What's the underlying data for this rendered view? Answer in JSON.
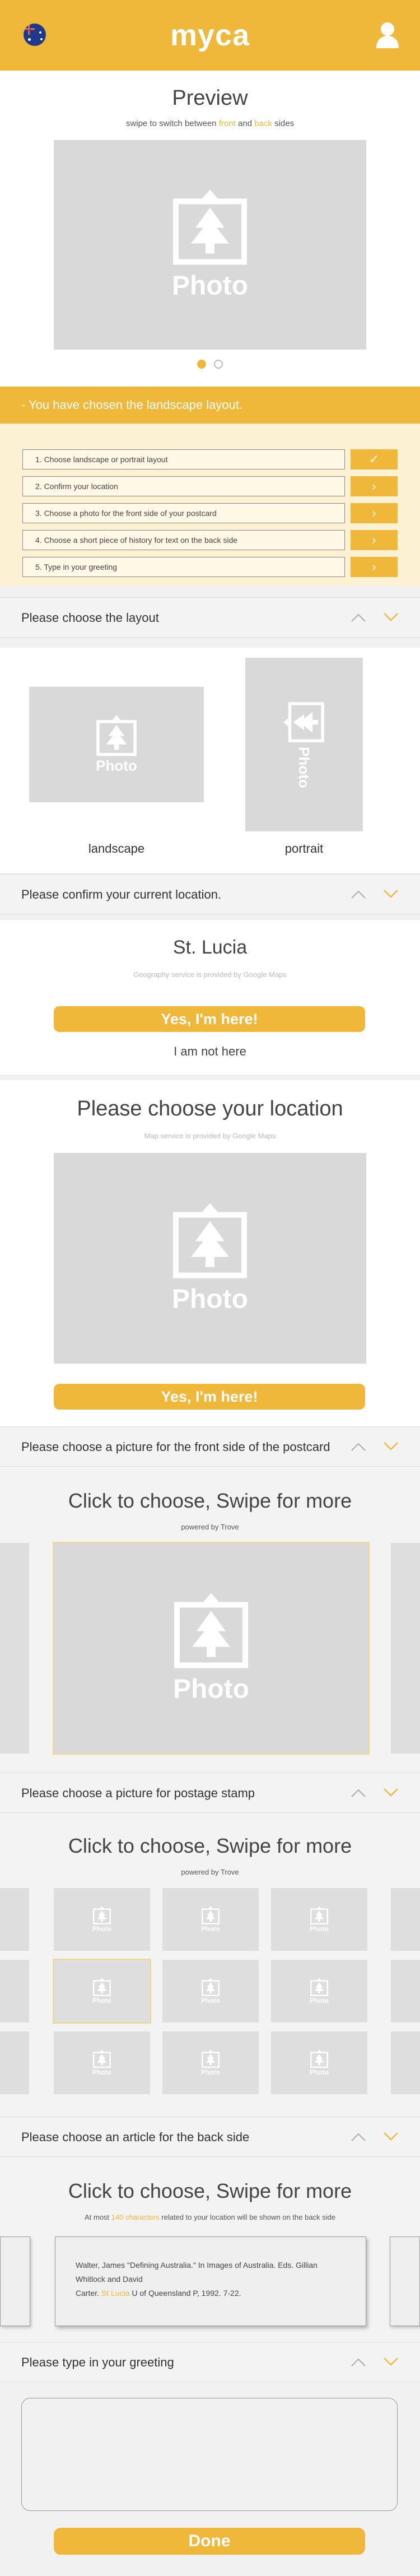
{
  "header": {
    "flag_icon": "australia-flag-icon",
    "logo": "myca",
    "user_icon": "user-icon",
    "brand_color": "#f0b83a"
  },
  "preview": {
    "title": "Preview",
    "hint_pre": "swipe to switch between ",
    "hint_front": "front",
    "hint_and": " and ",
    "hint_back": "back",
    "hint_post": " sides",
    "photo_label": "Photo",
    "dots_active": 0
  },
  "banner": "- You have chosen the landscape layout.",
  "steps": [
    {
      "label": "1. Choose landscape or portrait layout",
      "icon": "✓"
    },
    {
      "label": "2. Confirm your location",
      "icon": "›"
    },
    {
      "label": "3. Choose a photo for the front side of your postcard",
      "icon": "›"
    },
    {
      "label": "4. Choose a short piece of history for text on the back side",
      "icon": "›"
    },
    {
      "label": "5. Type in your greeting",
      "icon": "›"
    }
  ],
  "layout_section": {
    "header": "Please choose the layout",
    "landscape_label": "landscape",
    "portrait_label": "portrait",
    "photo_label": "Photo"
  },
  "confirm_section": {
    "header": "Please confirm your current location.",
    "place": "St. Lucia",
    "note": "Geography service is provided by Google Maps",
    "yes": "Yes, I'm here!",
    "no": "I am not here"
  },
  "choose_location": {
    "title": "Please choose your location",
    "note": "Map service is provided by Google Maps",
    "photo_label": "Photo",
    "yes": "Yes, I'm here!"
  },
  "front_section": {
    "header": "Please choose a  picture for the front side of the postcard",
    "title": "Click to choose, Swipe for more",
    "powered": "powered by Trove",
    "photo_label": "Photo"
  },
  "stamp_section": {
    "header": "Please choose a  picture for postage stamp",
    "title": "Click to choose, Swipe for more",
    "powered": "powered by Trove",
    "photo_label": "Photo"
  },
  "article_section": {
    "header": "Please choose an article for the back side",
    "title": "Click to choose, Swipe for more",
    "note_pre": "At most ",
    "note_hl": "140 characters",
    "note_post": " related to your location will be shown on the back side",
    "citation_line1": "Walter, James \"Defining Australia.\" In Images of Australia. Eds. Gillian",
    "citation_line2": "Whitlock and David",
    "citation_line3_pre": "Carter. ",
    "citation_line3_hl": "St Lucia",
    "citation_line3_post": " U of Queensland P, 1992. 7-22."
  },
  "greeting_section": {
    "header": "Please type in your greeting",
    "placeholder": ""
  },
  "done": "Done"
}
